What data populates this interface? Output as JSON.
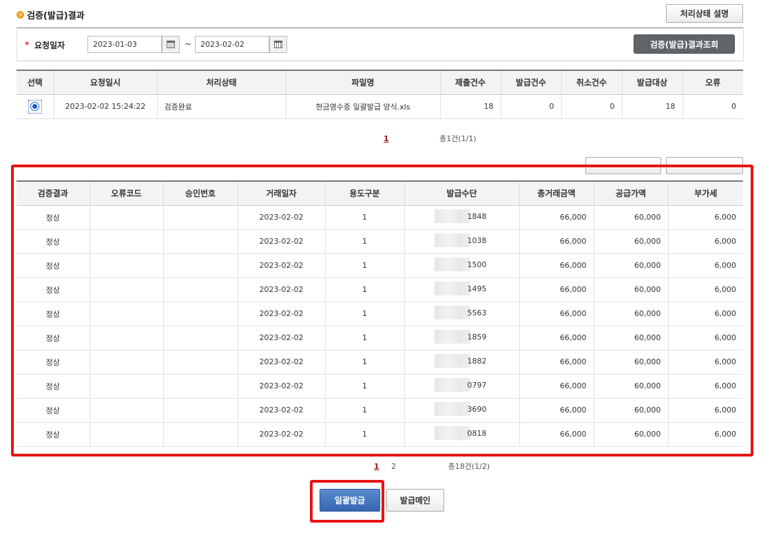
{
  "section1": {
    "title": "검증(발급)결과",
    "status_help_label": "처리상태 설명",
    "search": {
      "label": "요청일자",
      "required_mark": "*",
      "date_from": "2023-01-03",
      "tilde": "~",
      "date_to": "2023-02-02",
      "query_button": "검증(발급)결과조회"
    },
    "table": {
      "headers": [
        "선택",
        "요청일시",
        "처리상태",
        "파일명",
        "제출건수",
        "발급건수",
        "취소건수",
        "발급대상",
        "오류"
      ],
      "rows": [
        {
          "requested_at": "2023-02-02 15:24:22",
          "status": "검증완료",
          "file": "현금영수증 일괄발급 양식.xls",
          "submitted": "18",
          "issued": "0",
          "cancelled": "0",
          "target": "18",
          "error": "0"
        }
      ]
    },
    "pager": {
      "current": "1",
      "total": "총1건(1/1)"
    }
  },
  "section2": {
    "table": {
      "headers": [
        "검증결과",
        "오류코드",
        "승인번호",
        "거래일자",
        "용도구분",
        "발급수단",
        "총거래금액",
        "공급가액",
        "부가세"
      ],
      "rows": [
        {
          "result": "정상",
          "date": "2023-02-02",
          "usage": "1",
          "means_tail": "1848",
          "total": "66,000",
          "supply": "60,000",
          "vat": "6,000"
        },
        {
          "result": "정상",
          "date": "2023-02-02",
          "usage": "1",
          "means_tail": "1038",
          "total": "66,000",
          "supply": "60,000",
          "vat": "6,000"
        },
        {
          "result": "정상",
          "date": "2023-02-02",
          "usage": "1",
          "means_tail": "1500",
          "total": "66,000",
          "supply": "60,000",
          "vat": "6,000"
        },
        {
          "result": "정상",
          "date": "2023-02-02",
          "usage": "1",
          "means_tail": "1495",
          "total": "66,000",
          "supply": "60,000",
          "vat": "6,000"
        },
        {
          "result": "정상",
          "date": "2023-02-02",
          "usage": "1",
          "means_tail": "5563",
          "total": "66,000",
          "supply": "60,000",
          "vat": "6,000"
        },
        {
          "result": "정상",
          "date": "2023-02-02",
          "usage": "1",
          "means_tail": "1859",
          "total": "66,000",
          "supply": "60,000",
          "vat": "6,000"
        },
        {
          "result": "정상",
          "date": "2023-02-02",
          "usage": "1",
          "means_tail": "1882",
          "total": "66,000",
          "supply": "60,000",
          "vat": "6,000"
        },
        {
          "result": "정상",
          "date": "2023-02-02",
          "usage": "1",
          "means_tail": "0797",
          "total": "66,000",
          "supply": "60,000",
          "vat": "6,000"
        },
        {
          "result": "정상",
          "date": "2023-02-02",
          "usage": "1",
          "means_tail": "3690",
          "total": "66,000",
          "supply": "60,000",
          "vat": "6,000"
        },
        {
          "result": "정상",
          "date": "2023-02-02",
          "usage": "1",
          "means_tail": "0818",
          "total": "66,000",
          "supply": "60,000",
          "vat": "6,000"
        }
      ]
    },
    "pager": {
      "current": "1",
      "next": "2",
      "total": "총18건(1/2)"
    }
  },
  "actions": {
    "bulk_issue": "일괄발급",
    "issue_main": "발급메인"
  },
  "colors": {
    "highlight": "#e81313",
    "primary": "#3566b0",
    "accent": "#f0a020"
  }
}
